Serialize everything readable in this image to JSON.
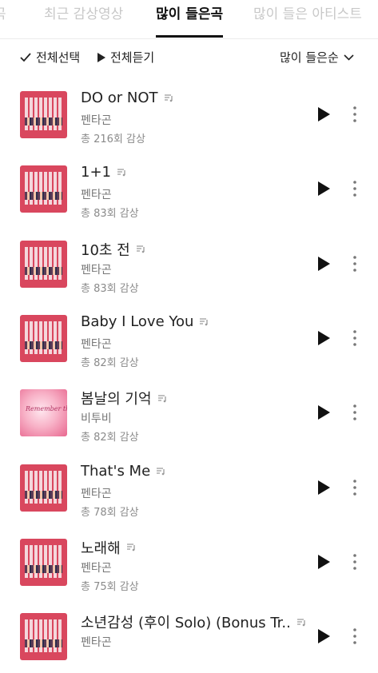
{
  "tabs": [
    {
      "label": "곡",
      "active": false
    },
    {
      "label": "최근 감상영상",
      "active": false
    },
    {
      "label": "많이 들은곡",
      "active": true
    },
    {
      "label": "많이 들은 아티스트",
      "active": false
    }
  ],
  "toolbar": {
    "select_all": "전체선택",
    "play_all": "전체듣기",
    "sort": "많이 들은순"
  },
  "songs": [
    {
      "title": "DO or NOT",
      "artist": "펜타곤",
      "count": "총 216회 감상",
      "cover": "pentagon-cover"
    },
    {
      "title": "1+1",
      "artist": "펜타곤",
      "count": "총 83회 감상",
      "cover": "pentagon-cover"
    },
    {
      "title": "10초 전",
      "artist": "펜타곤",
      "count": "총 83회 감상",
      "cover": "pentagon-cover"
    },
    {
      "title": "Baby I Love You",
      "artist": "펜타곤",
      "count": "총 82회 감상",
      "cover": "pentagon-cover"
    },
    {
      "title": "봄날의 기억",
      "artist": "비투비",
      "count": "총 82회 감상",
      "cover": "btob-cover",
      "cover_text": "Remember that"
    },
    {
      "title": "That's Me",
      "artist": "펜타곤",
      "count": "총 78회 감상",
      "cover": "pentagon-cover"
    },
    {
      "title": "노래해",
      "artist": "펜타곤",
      "count": "총 75회 감상",
      "cover": "pentagon-cover"
    },
    {
      "title": "소년감성 (후이 Solo) (Bonus Tr..",
      "artist": "펜타곤",
      "count": "",
      "cover": "pentagon-cover"
    }
  ],
  "icons": {
    "check": "check-icon",
    "play": "play-icon",
    "chevron": "chevron-down-icon",
    "lyrics": "lyrics-icon",
    "more": "more-vertical-icon"
  },
  "colors": {
    "active_tab": "#111111",
    "inactive_tab": "#c8c8c8",
    "pentagon_cover": "#d9475e",
    "btob_cover": "#f8b3c8"
  }
}
